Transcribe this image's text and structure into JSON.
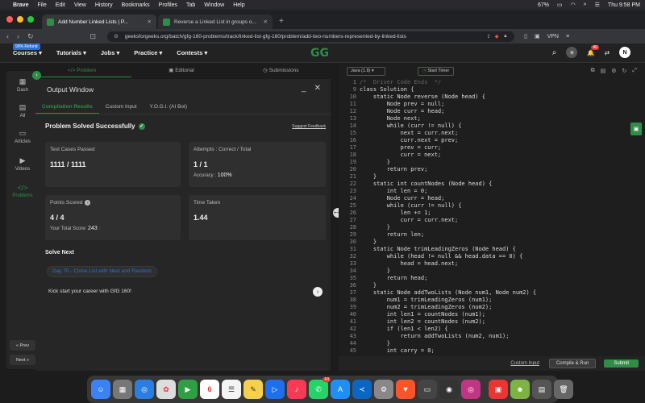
{
  "menubar": {
    "app": "Brave",
    "items": [
      "File",
      "Edit",
      "View",
      "History",
      "Bookmarks",
      "Profiles",
      "Tab",
      "Window",
      "Help"
    ],
    "battery": "67%",
    "datetime": "Thu 9:58 PM"
  },
  "tabs": [
    {
      "title": "Add Number Linked Lists | P..."
    },
    {
      "title": "Reverse a Linked List in groups o..."
    }
  ],
  "address": {
    "url": "geeksforgeeks.org/batch/gfg-160-problems/track/linked-list-gfg-160/problem/add-two-numbers-represented-by-linked-lists",
    "vpn": "VPN"
  },
  "sitenav": {
    "refund_badge": "90% Refund",
    "items": [
      "Courses",
      "Tutorials",
      "Jobs",
      "Practice",
      "Contests"
    ],
    "logo": "GG",
    "notif_count": "40",
    "avatar": "N"
  },
  "sidebar": {
    "items": [
      "Dash",
      "All",
      "Articles",
      "Videos",
      "Problems"
    ],
    "prev": "« Prev",
    "next": "Next »"
  },
  "problem_tabs": [
    "Problem",
    "Editorial",
    "Submissions"
  ],
  "output": {
    "title": "Output Window",
    "tabs": [
      "Compilation Results",
      "Custom Input",
      "Y.O.G.I. (AI Bot)"
    ],
    "status": "Problem Solved Successfully",
    "feedback": "Suggest Feedback",
    "test_cases_label": "Test Cases Passed",
    "test_cases_value": "1111 / 1111",
    "attempts_label": "Attempts : Correct / Total",
    "attempts_value": "1 / 1",
    "accuracy_label": "Accuracy :",
    "accuracy_value": "100%",
    "points_label": "Points Scored",
    "points_value": "4 / 4",
    "total_score_label": "Your Total Score:",
    "total_score_value": "243",
    "time_label": "Time Taken",
    "time_value": "1.44",
    "solve_next": "Solve Next",
    "next_problem": "Day 70 - Clone List with Next and Random",
    "kick": "Kick start your career with GfG 160!"
  },
  "editor": {
    "language": "Java (1.8)",
    "timer": "Start Timer",
    "lines": [
      {
        "n": "1",
        "code": "/*  Driver Code Ends  */"
      },
      {
        "n": "9",
        "code": "class Solution {"
      },
      {
        "n": "10",
        "code": "    static Node reverse (Node head) {"
      },
      {
        "n": "11",
        "code": "        Node prev = null;"
      },
      {
        "n": "12",
        "code": "        Node curr = head;"
      },
      {
        "n": "13",
        "code": "        Node next;"
      },
      {
        "n": "14",
        "code": "        while (curr != null) {"
      },
      {
        "n": "15",
        "code": "            next = curr.next;"
      },
      {
        "n": "16",
        "code": "            curr.next = prev;"
      },
      {
        "n": "17",
        "code": "            prev = curr;"
      },
      {
        "n": "18",
        "code": "            curr = next;"
      },
      {
        "n": "19",
        "code": "        }"
      },
      {
        "n": "20",
        "code": "        return prev;"
      },
      {
        "n": "21",
        "code": "    }"
      },
      {
        "n": "22",
        "code": "    static int countNodes (Node head) {"
      },
      {
        "n": "23",
        "code": "        int len = 0;"
      },
      {
        "n": "24",
        "code": "        Node curr = head;"
      },
      {
        "n": "25",
        "code": "        while (curr != null) {"
      },
      {
        "n": "26",
        "code": "            len += 1;"
      },
      {
        "n": "27",
        "code": "            curr = curr.next;"
      },
      {
        "n": "28",
        "code": "        }"
      },
      {
        "n": "29",
        "code": "        return len;"
      },
      {
        "n": "30",
        "code": "    }"
      },
      {
        "n": "31",
        "code": "    static Node trimLeadingZeros (Node head) {"
      },
      {
        "n": "32",
        "code": "        while (head != null && head.data == 0) {"
      },
      {
        "n": "33",
        "code": "            head = head.next;"
      },
      {
        "n": "34",
        "code": "        }"
      },
      {
        "n": "35",
        "code": "        return head;"
      },
      {
        "n": "36",
        "code": "    }"
      },
      {
        "n": "37",
        "code": "    static Node addTwoLists (Node num1, Node num2) {"
      },
      {
        "n": "38",
        "code": "        num1 = trimLeadingZeros (num1);"
      },
      {
        "n": "39",
        "code": "        num2 = trimLeadingZeros (num2);"
      },
      {
        "n": "40",
        "code": "        int len1 = countNodes (num1);"
      },
      {
        "n": "41",
        "code": "        int len2 = countNodes (num2);"
      },
      {
        "n": "42",
        "code": "        if (len1 < len2) {"
      },
      {
        "n": "43",
        "code": "            return addTwoLists (num2, num1);"
      },
      {
        "n": "44",
        "code": "        }"
      },
      {
        "n": "45",
        "code": "        int carry = 0;"
      }
    ],
    "custom_input": "Custom Input",
    "compile_run": "Compile & Run",
    "submit": "Submit"
  },
  "dock": {
    "calendar_day": "6",
    "whatsapp_badge": "64"
  },
  "colors": {
    "accent": "#2f8d46",
    "link": "#2f6fd1"
  }
}
